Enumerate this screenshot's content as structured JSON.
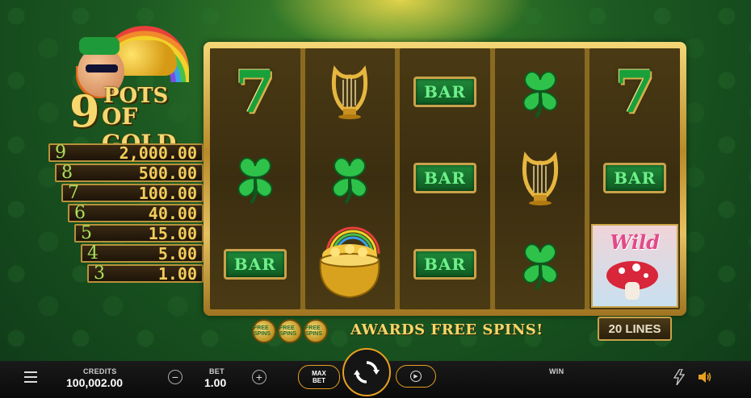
{
  "game": {
    "title_number": "9",
    "title_line1": "POTS",
    "title_line2": "OF GOLD"
  },
  "paytable": [
    {
      "count": "9",
      "amount": "2,000.00"
    },
    {
      "count": "8",
      "amount": "500.00"
    },
    {
      "count": "7",
      "amount": "100.00"
    },
    {
      "count": "6",
      "amount": "40.00"
    },
    {
      "count": "5",
      "amount": "15.00"
    },
    {
      "count": "4",
      "amount": "5.00"
    },
    {
      "count": "3",
      "amount": "1.00"
    }
  ],
  "reels": [
    [
      "seven",
      "clover",
      "bar"
    ],
    [
      "harp",
      "clover",
      "pot-of-gold"
    ],
    [
      "bar",
      "bar",
      "bar"
    ],
    [
      "clover",
      "harp",
      "clover"
    ],
    [
      "seven",
      "bar",
      "wild"
    ]
  ],
  "symbols": {
    "seven_label": "7",
    "bar_label": "BAR",
    "wild_label": "Wild"
  },
  "free_spins": {
    "text": "AWARDS FREE SPINS!",
    "coin_label": "FREE SPINS"
  },
  "lines": {
    "label": "20 LINES"
  },
  "bottom_bar": {
    "credits_label": "CREDITS",
    "credits_value": "100,002.00",
    "bet_label": "BET",
    "bet_value": "1.00",
    "minus": "−",
    "plus": "+",
    "max_bet_line1": "MAX",
    "max_bet_line2": "BET",
    "win_label": "WIN"
  },
  "colors": {
    "accent": "#e8a020",
    "gold": "#f2cc5a",
    "green": "#1aa03a"
  }
}
